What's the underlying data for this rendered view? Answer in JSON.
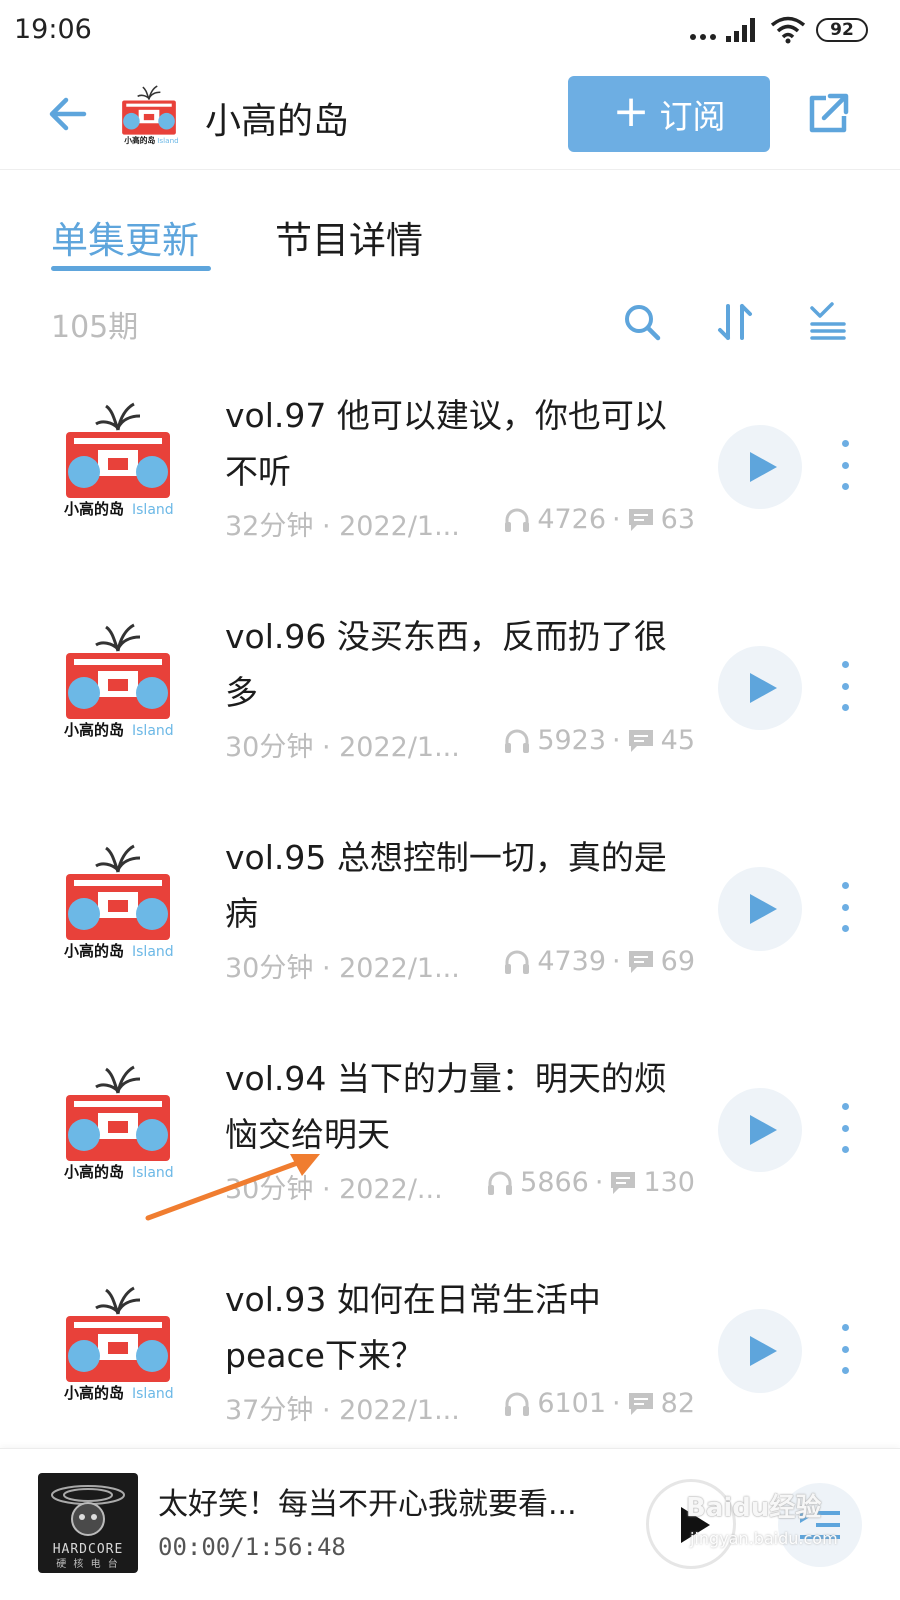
{
  "status_bar": {
    "time": "19:06",
    "battery": "92"
  },
  "header": {
    "title": "小高的岛",
    "subscribe_label": "订阅"
  },
  "tabs": [
    {
      "label": "单集更新",
      "active": true
    },
    {
      "label": "节目详情",
      "active": false
    }
  ],
  "toolbar": {
    "episode_count": "105期"
  },
  "podcast_logo": {
    "main_text": "小高的岛",
    "accent_text": "Island"
  },
  "episodes": [
    {
      "title": "vol.97 他可以建议，你也可以不听",
      "meta": "32分钟 · 2022/1...",
      "plays": "4726",
      "comments": "63"
    },
    {
      "title": "vol.96 没买东西，反而扔了很多",
      "meta": "30分钟 · 2022/1...",
      "plays": "5923",
      "comments": "45"
    },
    {
      "title": "vol.95 总想控制一切，真的是病",
      "meta": "30分钟 · 2022/1...",
      "plays": "4739",
      "comments": "69"
    },
    {
      "title": "vol.94 当下的力量：明天的烦恼交给明天",
      "meta": "30分钟 · 2022/...",
      "plays": "5866",
      "comments": "130"
    },
    {
      "title": "vol.93 如何在日常生活中peace下来？",
      "meta": "37分钟 · 2022/1...",
      "plays": "6101",
      "comments": "82"
    }
  ],
  "mini_player": {
    "title": "太好笑！每当不开心我就要看...",
    "time": "00:00/1:56:48",
    "cover_text": "HARDCORE",
    "cover_sub": "硬 核 电 台"
  },
  "watermark": {
    "text": "Baidu经验",
    "sub": "jingyan.baidu.com"
  },
  "colors": {
    "accent": "#5ea5dc",
    "subscribe_bg": "#6daee3",
    "logo_red": "#e8413a",
    "logo_blue": "#6cb8e6",
    "annotation": "#f07d30"
  }
}
